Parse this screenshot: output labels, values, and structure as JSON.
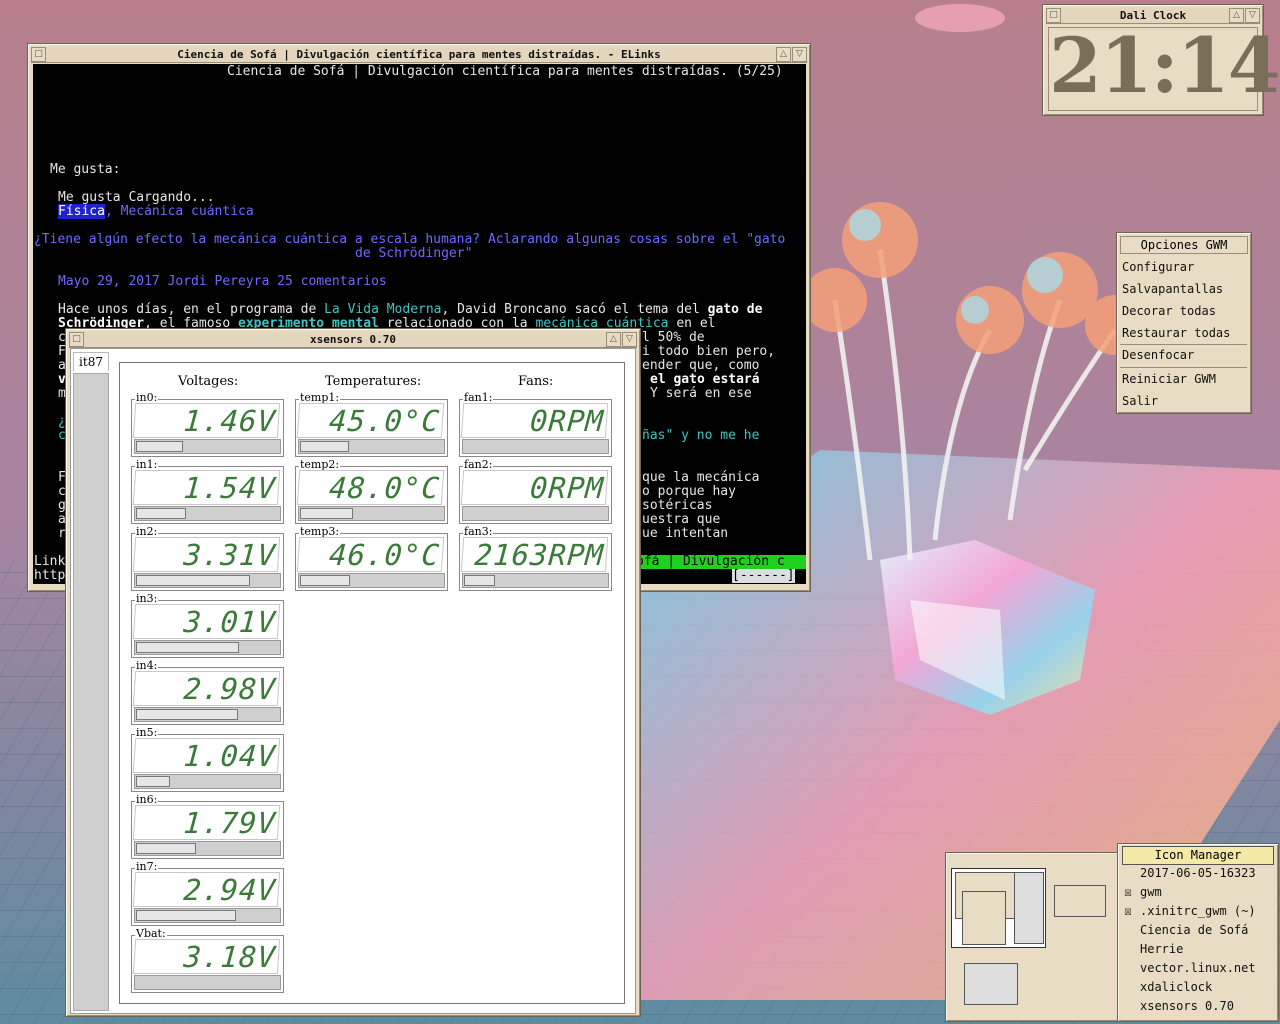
{
  "elinks": {
    "title": "Ciencia de Sofá | Divulgación científica para mentes distraídas. - ELinks",
    "header": "Ciencia de Sofá | Divulgación científica para mentes distraídas. (5/25)",
    "me_gusta": "Me gusta:",
    "me_gusta_cargando": "Me gusta Cargando...",
    "fisica": "Física",
    "mecanica_cuantica": ", Mecánica cuántica",
    "article_title_1": "¿Tiene algún efecto la mecánica cuántica a escala humana? Aclarando algunas cosas sobre el \"gato",
    "article_title_2": "de Schrödinger\"",
    "byline": "Mayo 29, 2017 Jordi Pereyra 25 comentarios",
    "p1_a": "Hace unos días, en el programa de ",
    "p1_link": "La Vida Moderna",
    "p1_b": ", David Broncano sacó el tema del ",
    "p1_bold": "gato de",
    "p2_bold": "Schrödinger",
    "p2_a": ", el famoso ",
    "p2_link1": "experimento mental",
    "p2_b": " relacionado con la ",
    "p2_link2": "mecánica cuántica",
    "p2_c": " en el",
    "r1": "l 50% de",
    "r2": "i todo bien pero,",
    "r3": "ender que, como",
    "r4_bold": "el gato estará",
    "r5": "Y será en ese",
    "r6": "ñas\" y no me he",
    "r7": "que la mecánica",
    "r8": "o porque hay",
    "r9": "sotéricas",
    "r10": "uestra que",
    "r11": "ue intentan",
    "left_l1": "c",
    "left_l2": "F",
    "left_l3": "a",
    "left_l4": "v",
    "left_l5": "m",
    "left_l6": "¿",
    "left_l7": "c",
    "left_l8": "F",
    "left_l9": "c",
    "left_l10": "g",
    "left_l11": "a",
    "left_l12": "r",
    "status_link": "Link",
    "status_url": "http",
    "status_right": "ofá | Divulgación c",
    "status_progress": "[------]"
  },
  "xsensors": {
    "title": "xsensors 0.70",
    "tab": "it87",
    "voltages_label": "Voltages:",
    "temps_label": "Temperatures:",
    "fans_label": "Fans:",
    "voltages": [
      {
        "label": "in0:",
        "value": "1.46V",
        "level": 0.33
      },
      {
        "label": "in1:",
        "value": "1.54V",
        "level": 0.35
      },
      {
        "label": "in2:",
        "value": "3.31V",
        "level": 0.8
      },
      {
        "label": "in3:",
        "value": "3.01V",
        "level": 0.72
      },
      {
        "label": "in4:",
        "value": "2.98V",
        "level": 0.71
      },
      {
        "label": "in5:",
        "value": "1.04V",
        "level": 0.24
      },
      {
        "label": "in6:",
        "value": "1.79V",
        "level": 0.42
      },
      {
        "label": "in7:",
        "value": "2.94V",
        "level": 0.7
      },
      {
        "label": "Vbat:",
        "value": "3.18V",
        "level": 0
      }
    ],
    "temps": [
      {
        "label": "temp1:",
        "value": "45.0°C",
        "level": 0.34
      },
      {
        "label": "temp2:",
        "value": "48.0°C",
        "level": 0.37
      },
      {
        "label": "temp3:",
        "value": "46.0°C",
        "level": 0.35
      }
    ],
    "fans": [
      {
        "label": "fan1:",
        "value": "0RPM",
        "level": 0
      },
      {
        "label": "fan2:",
        "value": "0RPM",
        "level": 0
      },
      {
        "label": "fan3:",
        "value": "2163RPM",
        "level": 0.22
      }
    ]
  },
  "clock": {
    "title": "Dali Clock",
    "time": "21:14"
  },
  "gwm_menu": {
    "title": "Opciones GWM",
    "items": [
      "Configurar",
      "Salvapantallas",
      "Decorar todas",
      "Restaurar todas",
      "Desenfocar",
      "Reiniciar GWM",
      "Salir"
    ]
  },
  "icon_manager": {
    "title": "Icon Manager",
    "items": [
      {
        "label": "2017-06-05-16323",
        "checked": false
      },
      {
        "label": "gwm",
        "checked": true
      },
      {
        "label": ".xinitrc_gwm (~)",
        "checked": true
      },
      {
        "label": "Ciencia de Sofá",
        "checked": false
      },
      {
        "label": "Herrie",
        "checked": false
      },
      {
        "label": "vector.linux.net",
        "checked": false
      },
      {
        "label": "xdaliclock",
        "checked": false
      },
      {
        "label": "xsensors 0.70",
        "checked": false
      }
    ]
  },
  "colors": {
    "lcd_green": "#3b7a3b",
    "elinks_blue": "#6b6bff",
    "elinks_cyan": "#3fc4c4",
    "elinks_status": "#1fd01f",
    "desktop_pink": "#b97a86"
  }
}
